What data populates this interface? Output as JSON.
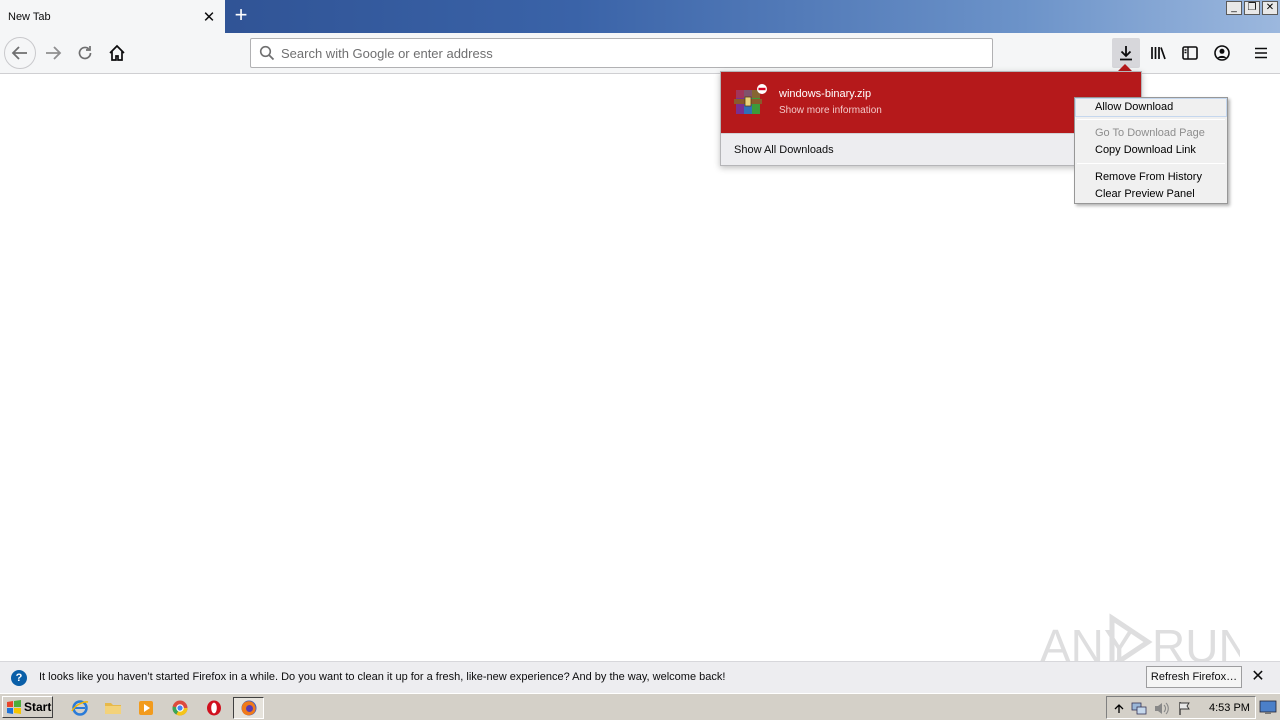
{
  "browser": {
    "tab_title": "New Tab",
    "new_tab_symbol": "+",
    "tab_close_symbol": "✕",
    "urlbar_placeholder": "Search with Google or enter address",
    "window_controls": {
      "minimize": "_",
      "restore": "❐",
      "close": "✕"
    }
  },
  "downloads_panel": {
    "file_name": "windows-binary.zip",
    "file_subtext": "Show more information",
    "show_all_label": "Show All Downloads",
    "blocked_color": "#b5191b"
  },
  "context_menu": {
    "items": [
      {
        "label": "Allow Download",
        "disabled": false
      },
      {
        "label": "Go To Download Page",
        "disabled": true
      },
      {
        "label": "Copy Download Link",
        "disabled": false
      },
      {
        "label": "Remove From History",
        "disabled": false
      },
      {
        "label": "Clear Preview Panel",
        "disabled": false
      }
    ]
  },
  "notification": {
    "message": "It looks like you haven’t started Firefox in a while. Do you want to clean it up for a fresh, like-new experience? And by the way, welcome back!",
    "button_label": "Refresh Firefox…",
    "close_symbol": "✕",
    "info_symbol": "?"
  },
  "taskbar": {
    "start_label": "Start",
    "clock": "4:53 PM"
  },
  "icons": {
    "back": "arrow-left-icon",
    "forward": "arrow-right-icon",
    "reload": "reload-icon",
    "home": "home-icon",
    "search": "search-icon",
    "downloads": "download-icon",
    "library": "library-icon",
    "sidebar": "sidebar-icon",
    "account": "account-icon",
    "menu": "hamburger-menu-icon"
  }
}
